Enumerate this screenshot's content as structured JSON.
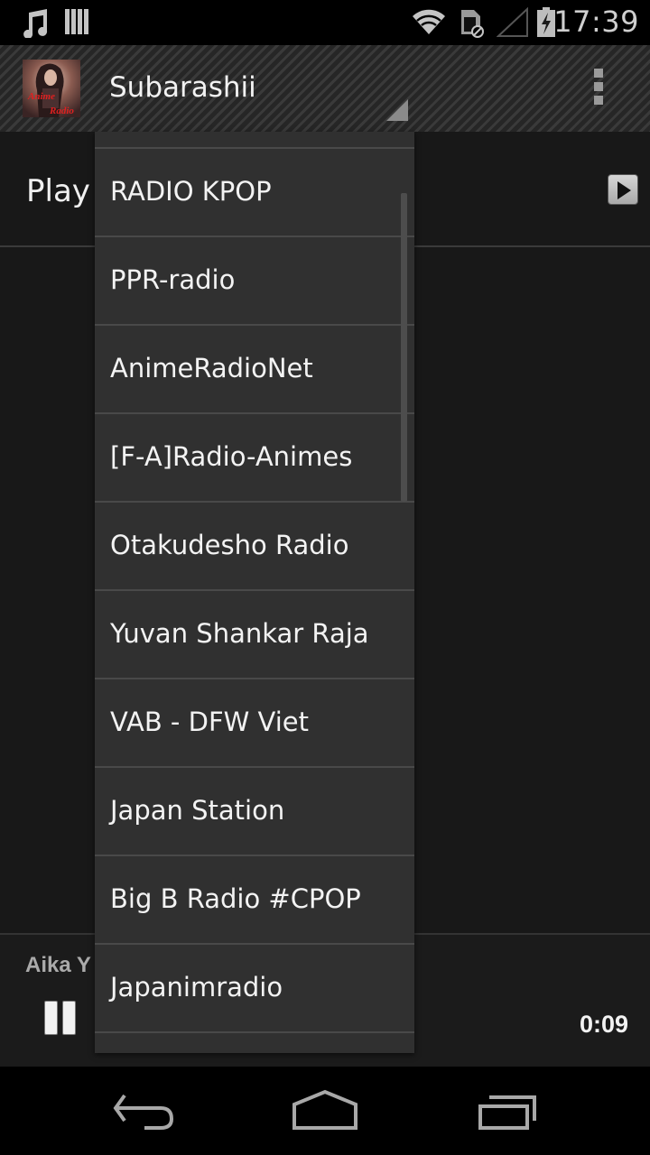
{
  "status_bar": {
    "time": "17:39",
    "icons": [
      "music-note-icon",
      "barcode-icon",
      "wifi-icon",
      "sim-blocked-icon",
      "signal-empty-icon",
      "battery-charging-icon"
    ]
  },
  "action_bar": {
    "station_title": "Subarashii",
    "album_art": "anime-radio-album-art",
    "overflow_icon": "overflow-menu-icon",
    "spinner_icon": "spinner-arrow-icon"
  },
  "content": {
    "play_label": "Play",
    "play_icon": "play-icon"
  },
  "now_playing": {
    "artist_visible": "Aika Y",
    "elapsed": "0:09",
    "pause_icon": "pause-icon"
  },
  "dropdown": {
    "items": [
      {
        "label": "RADIO KPOP"
      },
      {
        "label": "PPR-radio"
      },
      {
        "label": "AnimeRadioNet"
      },
      {
        "label": "[F-A]Radio-Animes"
      },
      {
        "label": "Otakudesho Radio"
      },
      {
        "label": "Yuvan Shankar Raja"
      },
      {
        "label": "VAB - DFW Viet"
      },
      {
        "label": "Japan Station"
      },
      {
        "label": "Big B Radio #CPOP"
      },
      {
        "label": "Japanimradio"
      }
    ]
  },
  "nav_bar": {
    "buttons": [
      "back-icon",
      "home-icon",
      "recent-apps-icon"
    ]
  },
  "colors": {
    "background": "#181818",
    "dropdown": "#303030",
    "divider": "#494949",
    "icon_gray": "#9a9a9a"
  }
}
